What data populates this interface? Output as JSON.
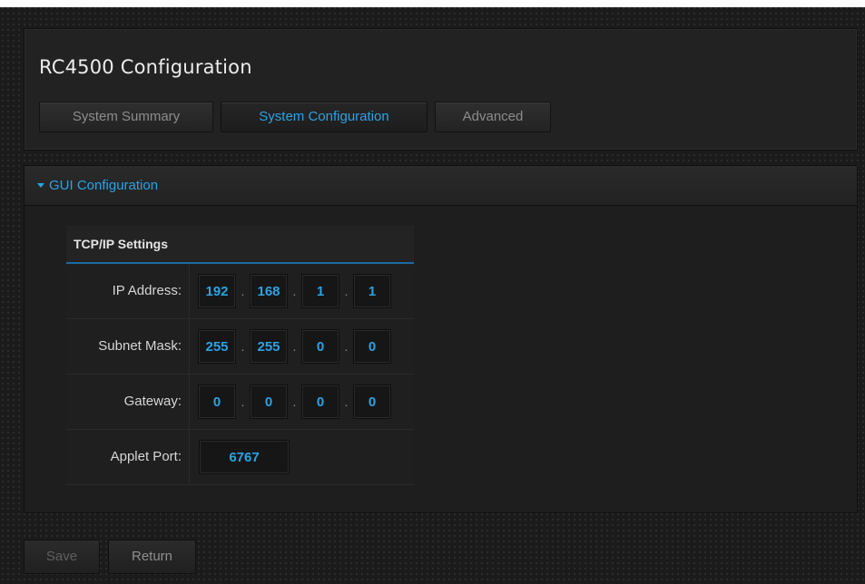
{
  "app": {
    "title": "RC4500 Configuration"
  },
  "tabs": [
    {
      "label": "System Summary",
      "active": false
    },
    {
      "label": "System Configuration",
      "active": true
    },
    {
      "label": "Advanced",
      "active": false
    }
  ],
  "section": {
    "title": "GUI Configuration",
    "expanded": true
  },
  "tcpip": {
    "header": "TCP/IP Settings",
    "rows": [
      {
        "label": "IP Address:",
        "octets": [
          "192",
          "168",
          "1",
          "1"
        ]
      },
      {
        "label": "Subnet Mask:",
        "octets": [
          "255",
          "255",
          "0",
          "0"
        ]
      },
      {
        "label": "Gateway:",
        "octets": [
          "0",
          "0",
          "0",
          "0"
        ]
      }
    ],
    "separator": ".",
    "applet_port": {
      "label": "Applet Port:",
      "value": "6767"
    }
  },
  "footer": {
    "save_label": "Save",
    "return_label": "Return",
    "save_enabled": false
  },
  "colors": {
    "accent": "#2aa3e6",
    "background": "#1b1b1b"
  }
}
